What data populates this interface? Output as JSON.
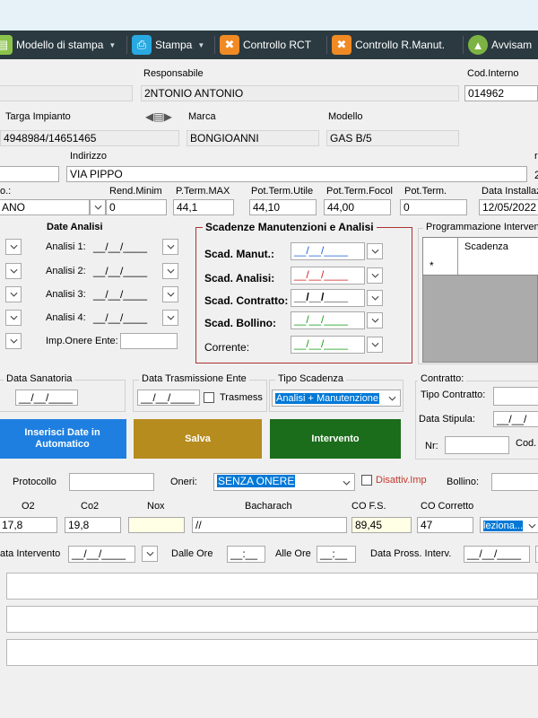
{
  "toolbar": {
    "btn_modello": "Modello di stampa",
    "btn_stampa": "Stampa",
    "btn_rct": "Controllo RCT",
    "btn_rmanut": "Controllo R.Manut.",
    "btn_avvisi": "Avvisam"
  },
  "header": {
    "responsabile_label": "Responsabile",
    "responsabile_value": "2NTONIO ANTONIO",
    "cod_interno_label": "Cod.Interno",
    "cod_interno_value": "014962",
    "targa_label": "Targa Impianto",
    "targa_value": "4948984/14651465",
    "marca_label": "Marca",
    "marca_value": "BONGIOANNI",
    "modello_label": "Modello",
    "modello_value": "GAS B/5",
    "indirizzo_label": "Indirizzo",
    "indirizzo_value": "VIA PIPPO",
    "right_cut_label": "r",
    "right_cut_value": "2"
  },
  "tech": {
    "comb_label": "o.:",
    "comb_value": "ANO",
    "rend_label": "Rend.Minim",
    "rend_value": "0",
    "pterm_max_label": "P.Term.MAX",
    "pterm_max_value": "44,1",
    "pot_utile_label": "Pot.Term.Utile",
    "pot_utile_value": "44,10",
    "pot_focol_label": "Pot.Term.Focol",
    "pot_focol_value": "44,00",
    "pot_term_label": "Pot.Term.",
    "pot_term_value": "0",
    "data_install_label": "Data Installaz",
    "data_install_value": "12/05/2022"
  },
  "date_analisi": {
    "title": "Date Analisi",
    "a1": "Analisi 1:",
    "a2": "Analisi 2:",
    "a3": "Analisi 3:",
    "a4": "Analisi 4:",
    "empty_date": "__/__/____",
    "imp_onere": "Imp.Onere Ente:"
  },
  "scadenze": {
    "title": "Scadenze Manutenzioni e Analisi",
    "manut": "Scad. Manut.:",
    "analisi": "Scad. Analisi:",
    "contratto": "Scad. Contratto:",
    "bollino": "Scad. Bollino:",
    "corrente": "Corrente:",
    "empty_date": "__/__/____",
    "manut_color": "#1a5fd6",
    "analisi_color": "#d21f1f",
    "contratto_color": "#000000",
    "bollino_color": "#159a15",
    "corrente_color": "#159a15"
  },
  "programmazione": {
    "title": "Programmazione Interventi",
    "col_scadenza": "Scadenza",
    "row_marker": "*"
  },
  "mid": {
    "data_sanatoria_label": "Data Sanatoria",
    "data_sanatoria_value": "__/__/____",
    "data_trasm_label": "Data Trasmissione Ente",
    "data_trasm_value": "__/__/____",
    "trasmesso_label": "Trasmesso",
    "tipo_scad_label": "Tipo Scadenza",
    "tipo_scad_value": "Analisi + Manutenzione",
    "contratto_label": "Contratto:",
    "tipo_contratto_label": "Tipo Contratto:",
    "data_stipula_label": "Data Stipula:",
    "data_stipula_value": "__/__/",
    "nr_label": "Nr:",
    "cod_label": "Cod."
  },
  "actions": {
    "inserisci": "Inserisci Date in Automatico",
    "salva": "Salva",
    "intervento": "Intervento"
  },
  "protocol": {
    "protocollo_label": "Protocollo",
    "oneri_label": "Oneri:",
    "oneri_value": "SENZA ONERE",
    "disattiv_label": "Disattiv.Imp",
    "bollino_label": "Bollino:"
  },
  "measures": {
    "o2_label": "O2",
    "co2_label": "Co2",
    "nox_label": "Nox",
    "bacharach_label": "Bacharach",
    "cofs_label": "CO F.S.",
    "cocorr_label": "CO Corretto",
    "o2_value": "17,8",
    "co2_value": "19,8",
    "nox_value": "",
    "bacharach_value": "//",
    "cofs_value": "89,45",
    "cocorr_value": "47",
    "select_value": "leziona..."
  },
  "intervento": {
    "data_label": "ata Intervento",
    "data_value": "__/__/____",
    "dalle_label": "Dalle Ore",
    "dalle_value": "__:__",
    "alle_label": "Alle Ore",
    "alle_value": "__:__",
    "prox_label": "Data Pross. Interv.",
    "prox_value": "__/__/____"
  }
}
